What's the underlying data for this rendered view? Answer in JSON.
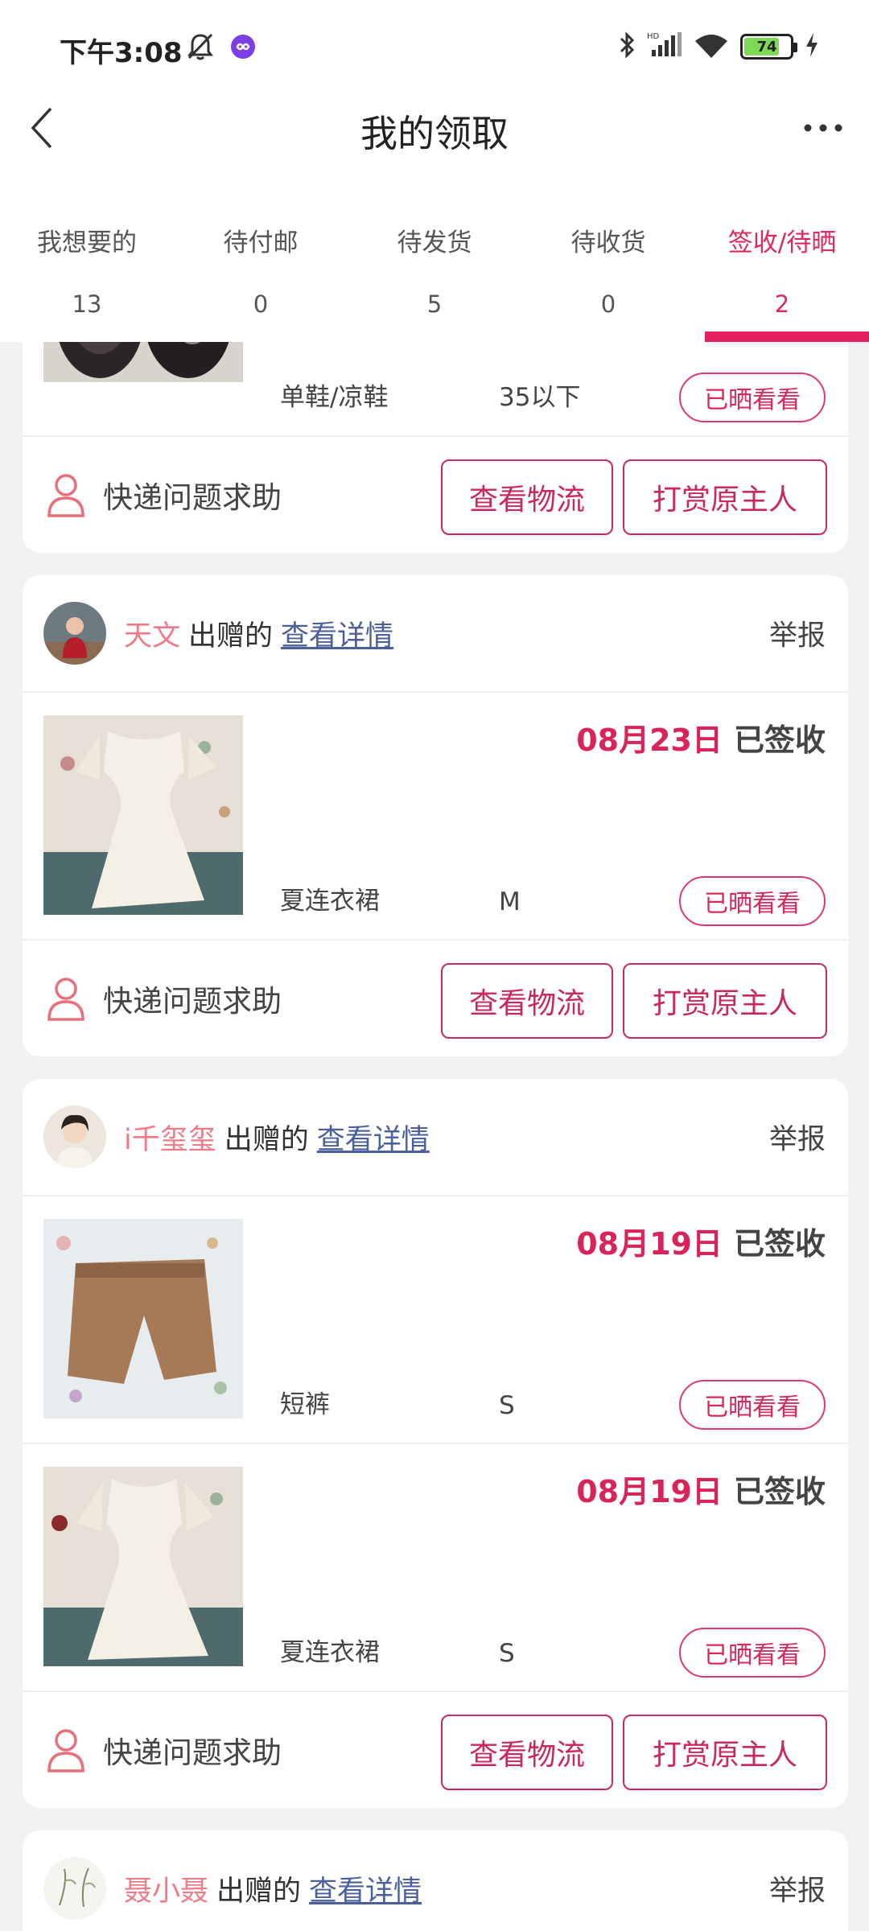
{
  "status_bar": {
    "time": "下午3:08",
    "battery": "74"
  },
  "nav": {
    "title": "我的领取"
  },
  "tabs": [
    {
      "label": "我想要的",
      "count": "13"
    },
    {
      "label": "待付邮",
      "count": "0"
    },
    {
      "label": "待发货",
      "count": "5"
    },
    {
      "label": "待收货",
      "count": "0"
    },
    {
      "label": "签收/待晒",
      "count": "2"
    }
  ],
  "colors": {
    "accent": "#e3215e",
    "donor_name": "#f07a86",
    "link": "#4a5f9b"
  },
  "common": {
    "donated_label": "出赠的",
    "detail_link": "查看详情",
    "report": "举报",
    "help_label": "快递问题求助",
    "logistics_button": "查看物流",
    "tip_button": "打赏原主人",
    "sun_button": "已晒看看",
    "status_signed": "已签收"
  },
  "cards": [
    {
      "items": [
        {
          "category": "单鞋/凉鞋",
          "size": "35以下"
        }
      ]
    },
    {
      "donor": "天文",
      "items": [
        {
          "date": "08月23日",
          "category": "夏连衣裙",
          "size": "M"
        }
      ]
    },
    {
      "donor": "i千玺玺",
      "items": [
        {
          "date": "08月19日",
          "category": "短裤",
          "size": "S"
        },
        {
          "date": "08月19日",
          "category": "夏连衣裙",
          "size": "S"
        }
      ]
    },
    {
      "donor": "聂小聂"
    }
  ]
}
